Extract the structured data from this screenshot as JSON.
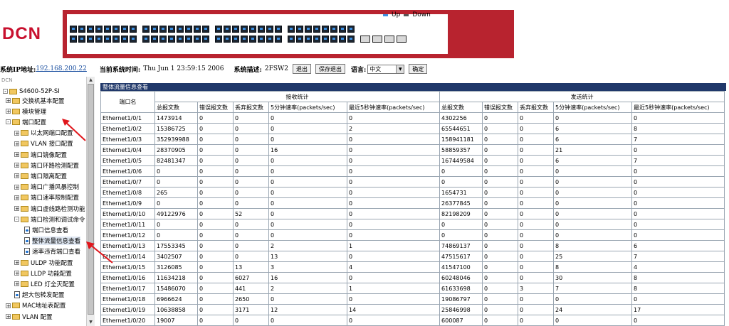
{
  "header": {
    "logo": "DCN",
    "legend_up": "Up",
    "legend_down": "Down",
    "legend_up_color": "#3a8fe2",
    "legend_down_color": "#555555",
    "panel_color": "#b8232f"
  },
  "infobar": {
    "ip_label": "系统IP地址:",
    "ip_value": "192.168.200.22",
    "time_label": "当前系统时间:",
    "time_value": "Thu Jun 1 23:59:15 2006",
    "desc_label": "系统描述:",
    "desc_value": "2FSW2",
    "exit_button": "退出",
    "save_exit_button": "保存退出",
    "lang_label": "语言:",
    "lang_value": "中文",
    "ok_button": "确定"
  },
  "sidebar": {
    "caption": "DCN",
    "root": "S4600-52P-SI",
    "items": [
      {
        "label": "交换机基本配置",
        "expander": "+"
      },
      {
        "label": "模块管理",
        "expander": "+"
      },
      {
        "label": "端口配置",
        "expander": "-"
      },
      {
        "label": "以太网端口配置",
        "expander": "+"
      },
      {
        "label": "VLAN 接口配置",
        "expander": "+"
      },
      {
        "label": "端口镜像配置",
        "expander": "+"
      },
      {
        "label": "端口环路检测配置",
        "expander": "+"
      },
      {
        "label": "端口隔离配置",
        "expander": "+"
      },
      {
        "label": "端口广播风暴控制",
        "expander": "+"
      },
      {
        "label": "端口速率限制配置",
        "expander": "+"
      },
      {
        "label": "端口虚线路检测功能",
        "expander": "+"
      },
      {
        "label": "端口检测和调试命令",
        "expander": "-"
      },
      {
        "label": "端口信息查看",
        "expander": ""
      },
      {
        "label": "整体流量信息查看",
        "expander": ""
      },
      {
        "label": "速率违背端口查看",
        "expander": ""
      },
      {
        "label": "ULDP 功能配置",
        "expander": "+"
      },
      {
        "label": "LLDP 功能配置",
        "expander": "+"
      },
      {
        "label": "LED 灯全灭配置",
        "expander": "+"
      },
      {
        "label": "超大包转发配置",
        "expander": ""
      },
      {
        "label": "MAC地址表配置",
        "expander": "+"
      },
      {
        "label": "VLAN 配置",
        "expander": "+"
      }
    ]
  },
  "panel": {
    "title": "整体流量信息查看",
    "port_header": "端口名",
    "recv_group": "接收统计",
    "send_group": "发送统计",
    "recv_columns": [
      "总报文数",
      "错误报文数",
      "丢弃报文数",
      "5分钟速率(packets/sec)",
      "最近5秒钟速率(packets/sec)"
    ],
    "send_columns": [
      "总报文数",
      "错误报文数",
      "丢弃报文数",
      "5分钟速率(packets/sec)",
      "最近5秒钟速率(packets/sec)"
    ],
    "rows": [
      [
        "Ethernet1/0/1",
        "1473914",
        "0",
        "0",
        "0",
        "0",
        "4302256",
        "0",
        "0",
        "0",
        "0"
      ],
      [
        "Ethernet1/0/2",
        "15386725",
        "0",
        "0",
        "0",
        "2",
        "65544651",
        "0",
        "0",
        "6",
        "8"
      ],
      [
        "Ethernet1/0/3",
        "352939988",
        "0",
        "0",
        "0",
        "0",
        "158941181",
        "0",
        "0",
        "6",
        "7"
      ],
      [
        "Ethernet1/0/4",
        "28370905",
        "0",
        "0",
        "16",
        "0",
        "58859357",
        "0",
        "0",
        "21",
        "0"
      ],
      [
        "Ethernet1/0/5",
        "82481347",
        "0",
        "0",
        "0",
        "0",
        "167449584",
        "0",
        "0",
        "6",
        "7"
      ],
      [
        "Ethernet1/0/6",
        "0",
        "0",
        "0",
        "0",
        "0",
        "0",
        "0",
        "0",
        "0",
        "0"
      ],
      [
        "Ethernet1/0/7",
        "0",
        "0",
        "0",
        "0",
        "0",
        "0",
        "0",
        "0",
        "0",
        "0"
      ],
      [
        "Ethernet1/0/8",
        "265",
        "0",
        "0",
        "0",
        "0",
        "1654731",
        "0",
        "0",
        "0",
        "0"
      ],
      [
        "Ethernet1/0/9",
        "0",
        "0",
        "0",
        "0",
        "0",
        "26377845",
        "0",
        "0",
        "0",
        "0"
      ],
      [
        "Ethernet1/0/10",
        "49122976",
        "0",
        "52",
        "0",
        "0",
        "82198209",
        "0",
        "0",
        "0",
        "0"
      ],
      [
        "Ethernet1/0/11",
        "0",
        "0",
        "0",
        "0",
        "0",
        "0",
        "0",
        "0",
        "0",
        "0"
      ],
      [
        "Ethernet1/0/12",
        "0",
        "0",
        "0",
        "0",
        "0",
        "0",
        "0",
        "0",
        "0",
        "0"
      ],
      [
        "Ethernet1/0/13",
        "17553345",
        "0",
        "0",
        "2",
        "1",
        "74869137",
        "0",
        "0",
        "8",
        "6"
      ],
      [
        "Ethernet1/0/14",
        "3402507",
        "0",
        "0",
        "13",
        "0",
        "47515617",
        "0",
        "0",
        "25",
        "7"
      ],
      [
        "Ethernet1/0/15",
        "3126085",
        "0",
        "13",
        "3",
        "4",
        "41547100",
        "0",
        "0",
        "8",
        "4"
      ],
      [
        "Ethernet1/0/16",
        "11634218",
        "0",
        "6027",
        "16",
        "0",
        "60248046",
        "0",
        "0",
        "30",
        "8"
      ],
      [
        "Ethernet1/0/17",
        "15486070",
        "0",
        "441",
        "2",
        "1",
        "61633698",
        "0",
        "3",
        "7",
        "8"
      ],
      [
        "Ethernet1/0/18",
        "6966624",
        "0",
        "2650",
        "0",
        "0",
        "19086797",
        "0",
        "0",
        "0",
        "0"
      ],
      [
        "Ethernet1/0/19",
        "10638858",
        "0",
        "3171",
        "12",
        "14",
        "25846998",
        "0",
        "0",
        "24",
        "17"
      ],
      [
        "Ethernet1/0/20",
        "19007",
        "0",
        "0",
        "0",
        "0",
        "600087",
        "0",
        "0",
        "0",
        "0"
      ]
    ]
  }
}
